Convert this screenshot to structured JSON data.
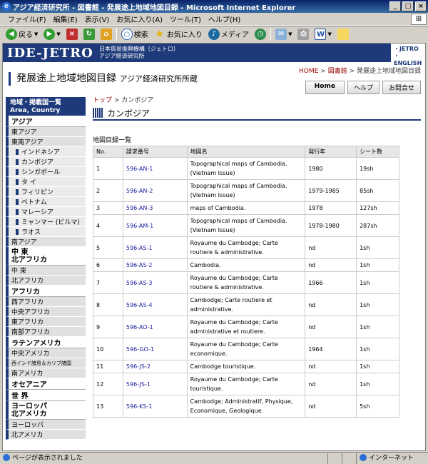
{
  "window": {
    "title": "アジア経済研究所 - 図書館 - 発展途上地域地図目録 - Microsoft Internet Explorer"
  },
  "menu": [
    "ファイル(F)",
    "編集(E)",
    "表示(V)",
    "お気に入り(A)",
    "ツール(T)",
    "ヘルプ(H)"
  ],
  "toolbar": {
    "back": "戻る",
    "search": "検索",
    "favorites": "お気に入り",
    "media": "メディア"
  },
  "banner": {
    "logo": "IDE-JETRO",
    "org_line1": "日本貿易振興機構（ジェトロ）",
    "org_line2": "アジア経済研究所",
    "link1": "・JETRO",
    "link2": "・ENGLISH"
  },
  "header": {
    "crumb_home": "HOME",
    "crumb_sep": " > ",
    "crumb_lib": "図書館",
    "crumb_current": "発展途上地域地図目録",
    "title": "発展途上地域地図目録",
    "subtitle": "アジア経済研究所所蔵",
    "btn_home": "Home",
    "btn_help": "ヘルプ",
    "btn_contact": "お問合せ"
  },
  "sidebar": {
    "head1": "地域・掲載国一覧",
    "head2": "Area, Country",
    "asia": "アジア",
    "east_asia": "東アジア",
    "se_asia": "東南アジア",
    "indonesia": "インドネシア",
    "cambodia": "カンボジア",
    "singapore": "シンガポール",
    "thai": "タ イ",
    "philippines": "フィリピン",
    "vietnam": "ベトナム",
    "malaysia": "マレーシア",
    "myanmar": "ミャンマー (ビルマ)",
    "laos": "ラオス",
    "south_asia": "南アジア",
    "mideast1": "中 東",
    "mideast2": "北アフリカ",
    "mideast_sub": "中 東",
    "n_africa": "北アフリカ",
    "africa": "アフリカ",
    "w_africa": "西アフリカ",
    "c_africa": "中央アフリカ",
    "e_africa": "東アフリカ",
    "s_africa": "南部アフリカ",
    "latam": "ラテンアメリカ",
    "c_america": "中央アメリカ",
    "caribbean": "西インド諸島＆カリブ諸国",
    "s_america": "南アメリカ",
    "oceania": "オセアニア",
    "world": "世 界",
    "eu1": "ヨーロッパ",
    "eu2": "北アメリカ",
    "europe": "ヨーロッパ",
    "n_america": "北アメリカ"
  },
  "main": {
    "crumb_top": "トップ",
    "crumb_sep": " > ",
    "crumb_country": "カンボジア",
    "country": "カンボジア",
    "list_title": "地図目録一覧",
    "columns": [
      "No.",
      "請求番号",
      "地図名",
      "発行年",
      "シート数"
    ],
    "rows": [
      {
        "no": "1",
        "code": "596-AN-1",
        "name": "Topographical maps of Cambodia. (Vietnam Issue)",
        "year": "1980",
        "sheets": "19sh"
      },
      {
        "no": "2",
        "code": "596-AN-2",
        "name": "Topographical maps of Cambodia. (Vietnam Issue)",
        "year": "1979-1985",
        "sheets": "85sh"
      },
      {
        "no": "3",
        "code": "596-AN-3",
        "name": "maps of Cambodia.",
        "year": "1978",
        "sheets": "127sh"
      },
      {
        "no": "4",
        "code": "596-AM-1",
        "name": "Topographical maps of Cambodia. (Vietnam Issue)",
        "year": "1978-1980",
        "sheets": "287sh"
      },
      {
        "no": "5",
        "code": "596-AS-1",
        "name": "Royaume du Cambodge; Carte routiere & administrative.",
        "year": "nd",
        "sheets": "1sh"
      },
      {
        "no": "6",
        "code": "596-AS-2",
        "name": "Cambodia.",
        "year": "nd",
        "sheets": "1sh"
      },
      {
        "no": "7",
        "code": "596-AS-3",
        "name": "Royaume du Cambodge; Carte routiere & administrative.",
        "year": "1966",
        "sheets": "1sh"
      },
      {
        "no": "8",
        "code": "596-AS-4",
        "name": "Cambodge; Carte routiere et administrative.",
        "year": "nd",
        "sheets": "1sh"
      },
      {
        "no": "9",
        "code": "596-AO-1",
        "name": "Royaume du Cambodge; Carte administrative et routiere.",
        "year": "nd",
        "sheets": "1sh"
      },
      {
        "no": "10",
        "code": "596-GO-1",
        "name": "Royaume du Cambodge; Carte economique.",
        "year": "1964",
        "sheets": "1sh"
      },
      {
        "no": "11",
        "code": "596-JS-2",
        "name": "Cambodge touristique.",
        "year": "nd",
        "sheets": "1sh"
      },
      {
        "no": "12",
        "code": "596-JS-1",
        "name": "Royaume du Cambodge; Carte touristique.",
        "year": "nd",
        "sheets": "1sh"
      },
      {
        "no": "13",
        "code": "596-KS-1",
        "name": "Cambodge; Administratif, Physique, Economique, Geologique.",
        "year": "nd",
        "sheets": "5sh"
      }
    ]
  },
  "status": {
    "text": "ページが表示されました",
    "zone": "インターネット"
  }
}
